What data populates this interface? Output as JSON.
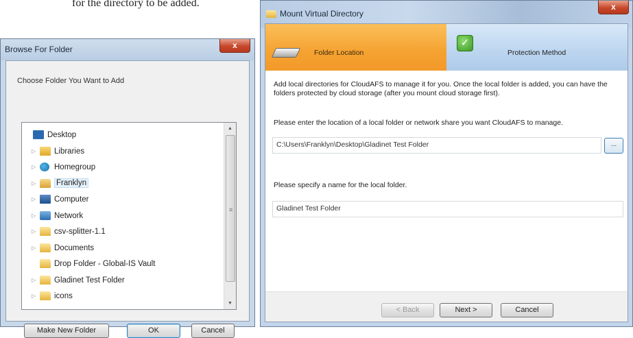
{
  "document": {
    "caption": "for the directory to be added."
  },
  "browse_dialog": {
    "title": "Browse For Folder",
    "close_label": "x",
    "instruction": "Choose Folder You Want to Add",
    "tree_items": [
      {
        "label": "Desktop",
        "icon": "desktop-icon",
        "expandable": false
      },
      {
        "label": "Libraries",
        "icon": "libraries-icon",
        "expandable": true
      },
      {
        "label": "Homegroup",
        "icon": "homegroup-icon",
        "expandable": true
      },
      {
        "label": "Franklyn",
        "icon": "user-folder-icon",
        "expandable": true,
        "selected": true
      },
      {
        "label": "Computer",
        "icon": "computer-icon",
        "expandable": true
      },
      {
        "label": "Network",
        "icon": "network-icon",
        "expandable": true
      },
      {
        "label": "csv-splitter-1.1",
        "icon": "folder-icon",
        "expandable": true
      },
      {
        "label": "Documents",
        "icon": "folder-icon",
        "expandable": true
      },
      {
        "label": "Drop Folder - Global-IS Vault",
        "icon": "folder-icon",
        "expandable": false
      },
      {
        "label": "Gladinet Test Folder",
        "icon": "folder-icon",
        "expandable": true
      },
      {
        "label": "icons",
        "icon": "folder-icon",
        "expandable": true
      }
    ],
    "buttons": {
      "make_new_folder": "Make New Folder",
      "ok": "OK",
      "cancel": "Cancel"
    }
  },
  "mount_dialog": {
    "title": "Mount Virtual Directory",
    "close_label": "x",
    "steps": [
      {
        "label": "Folder Location",
        "active": true,
        "color": "#f5a231"
      },
      {
        "label": "Protection Method",
        "active": false,
        "color": "#bcd5ef"
      }
    ],
    "description": "Add local directories for CloudAFS to manage it for you. Once the local folder is added, you can have the folders protected by cloud storage (after you mount cloud storage first).",
    "location_prompt": "Please enter the location of a local folder or network share you want CloudAFS to manage.",
    "location_value": "C:\\Users\\Franklyn\\Desktop\\Gladinet Test Folder",
    "browse_label": "...",
    "name_prompt": "Please specify a name for the local folder.",
    "name_value": "Gladinet Test Folder",
    "buttons": {
      "back": "< Back",
      "next": "Next >",
      "cancel": "Cancel"
    }
  }
}
